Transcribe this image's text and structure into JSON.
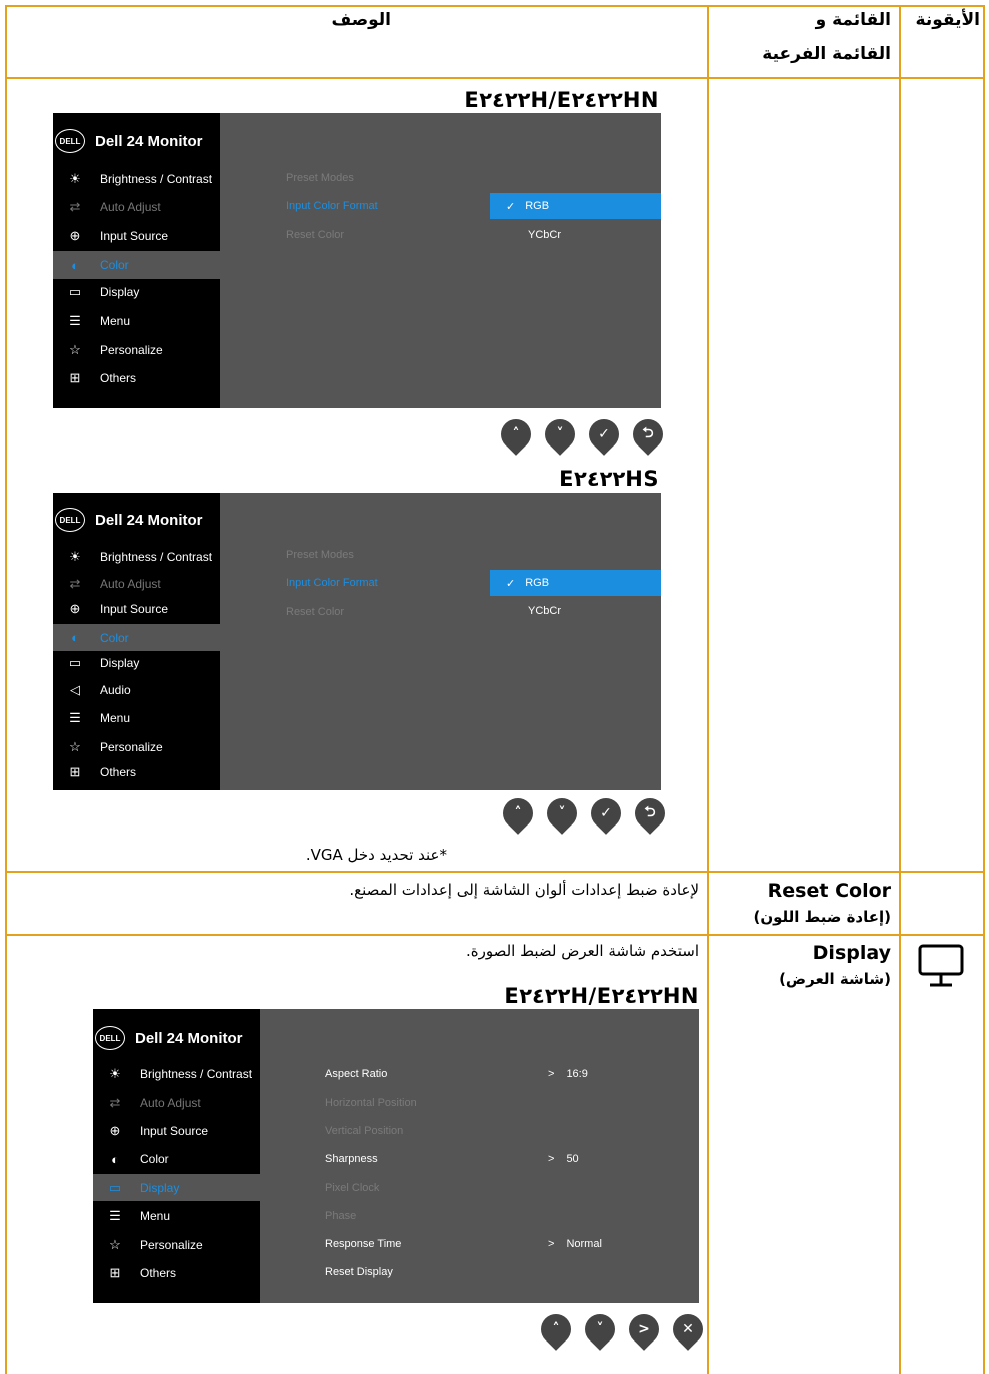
{
  "table_header": {
    "icon_col": "الأيقونة",
    "menu_col_line1": "القائمة و",
    "menu_col_line2": "القائمة الفرعية",
    "desc_col": "الوصف"
  },
  "color_section": {
    "model_title_1": "E٢٤٢٢H/E٢٤٢٢HN",
    "model_title_2": "E٢٤٢٢HS",
    "note": "*عند تحديد دخل VGA."
  },
  "osd_common": {
    "brand": "Dell 24 Monitor",
    "logo": "DELL"
  },
  "osd1": {
    "menu": [
      "Brightness / Contrast",
      "Auto Adjust",
      "Input Source",
      "Color",
      "Display",
      "Menu",
      "Personalize",
      "Others"
    ],
    "submenu": [
      "Preset Modes",
      "Input Color Format",
      "Reset Color"
    ],
    "options": [
      "RGB",
      "YCbCr"
    ],
    "check": "✓"
  },
  "osd2": {
    "menu": [
      "Brightness / Contrast",
      "Auto Adjust",
      "Input Source",
      "Color",
      "Display",
      "Audio",
      "Menu",
      "Personalize",
      "Others"
    ],
    "submenu": [
      "Preset Modes",
      "Input Color Format",
      "Reset Color"
    ],
    "options": [
      "RGB",
      "YCbCr"
    ],
    "check": "✓"
  },
  "reset_color": {
    "name": "Reset Color",
    "name_ar": "(إعادة ضبط اللون)",
    "desc": "لإعادة ضبط إعدادات ألوان الشاشة إلى إعدادات المصنع."
  },
  "display_section": {
    "name": "Display",
    "name_ar": "(شاشة العرض)",
    "desc": "استخدم شاشة العرض لضبط الصورة.",
    "model_title": "E٢٤٢٢H/E٢٤٢٢HN"
  },
  "osd3": {
    "menu": [
      "Brightness / Contrast",
      "Auto Adjust",
      "Input Source",
      "Color",
      "Display",
      "Menu",
      "Personalize",
      "Others"
    ],
    "submenu": [
      "Aspect Ratio",
      "Horizontal Position",
      "Vertical Position",
      "Sharpness",
      "Pixel Clock",
      "Phase",
      "Response Time",
      "Reset Display"
    ],
    "values": {
      "aspect": "16:9",
      "sharpness": "50",
      "response": "Normal"
    },
    "arrow": ">"
  },
  "buttons_a": [
    "˄",
    "˅",
    "✓",
    "⮌"
  ],
  "buttons_b": [
    "˄",
    "˅",
    ">",
    "✕"
  ],
  "icons": {
    "brightness": "☀",
    "auto_adjust": "⇄",
    "input_source": "⊕",
    "color": "◐",
    "display": "▭",
    "audio": "◁",
    "menu": "☰",
    "personalize": "☆",
    "others": "⊞"
  }
}
